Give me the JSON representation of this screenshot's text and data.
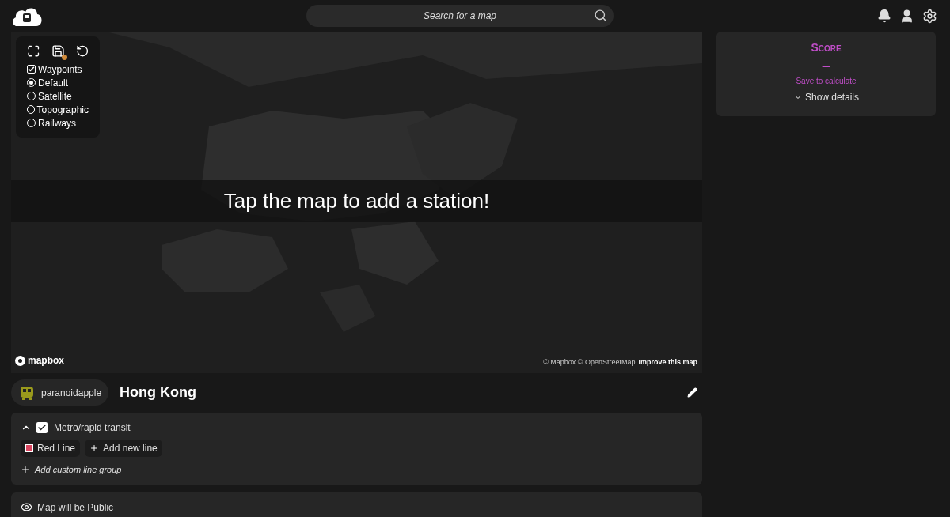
{
  "header": {
    "search": {
      "placeholder": "Search for a map"
    }
  },
  "map_controls": {
    "unsaved_changes": true,
    "layers": [
      {
        "kind": "checkbox",
        "label": "Waypoints",
        "checked": true
      },
      {
        "kind": "radio",
        "label": "Default",
        "selected": true
      },
      {
        "kind": "radio",
        "label": "Satellite",
        "selected": false
      },
      {
        "kind": "radio",
        "label": "Topographic",
        "selected": false
      },
      {
        "kind": "radio",
        "label": "Railways",
        "selected": false
      }
    ]
  },
  "map": {
    "prompt": "Tap the map to add a station!",
    "logo": "mapbox",
    "attribution": "© Mapbox © OpenStreetMap",
    "improve_link": "Improve this map"
  },
  "score": {
    "title": "Score",
    "value": "–",
    "hint": "Save to calculate",
    "details_toggle": "Show details",
    "expanded": false
  },
  "map_info": {
    "author": "paranoidapple",
    "title": "Hong Kong"
  },
  "line_groups": [
    {
      "label": "Metro/rapid transit",
      "expanded": true,
      "checked": true,
      "lines": [
        {
          "name": "Red Line",
          "color": "#d9455f"
        }
      ],
      "add_line": "Add new line"
    }
  ],
  "add_group": "Add custom line group",
  "visibility": {
    "label": "Map will be Public"
  }
}
